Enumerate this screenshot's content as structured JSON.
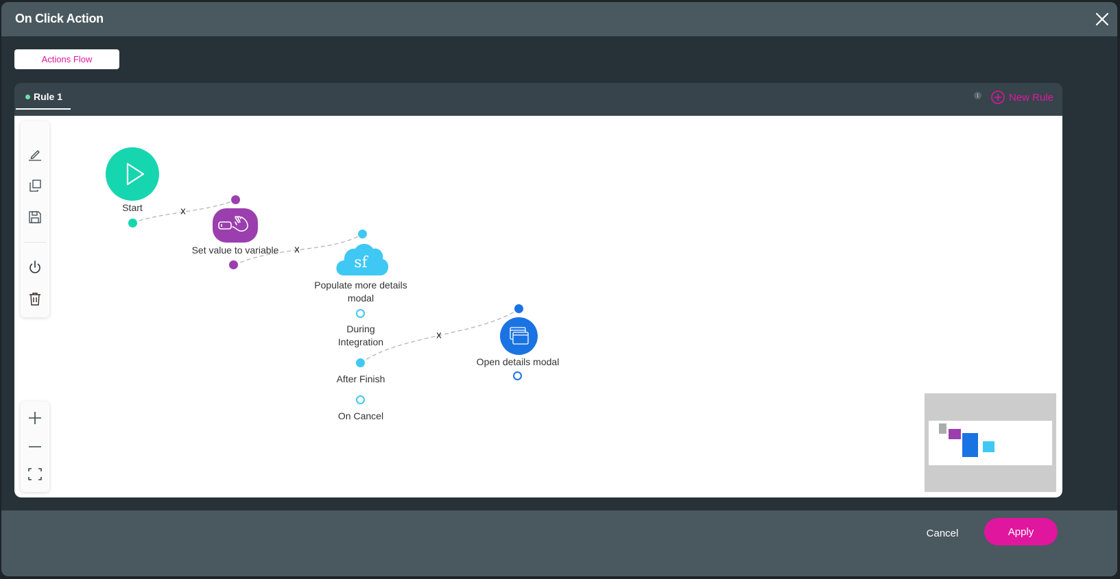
{
  "modal": {
    "title": "On Click Action",
    "close_icon": "close-icon"
  },
  "top_tab": {
    "label": "Actions Flow"
  },
  "rules": {
    "tabs": [
      {
        "label": "Rule 1",
        "active": true,
        "status_color": "#6fe0a8"
      }
    ],
    "info_icon": "info-icon",
    "new_rule_label": "New Rule"
  },
  "toolbar": {
    "items": [
      {
        "name": "edit",
        "icon": "pencil-icon"
      },
      {
        "name": "duplicate",
        "icon": "copy-icon"
      },
      {
        "name": "save",
        "icon": "save-icon"
      },
      {
        "name": "toggle-power",
        "icon": "power-icon"
      },
      {
        "name": "delete",
        "icon": "trash-icon"
      }
    ]
  },
  "zoom_controls": {
    "items": [
      {
        "name": "zoom-in",
        "icon": "plus-icon"
      },
      {
        "name": "zoom-out",
        "icon": "minus-icon"
      },
      {
        "name": "fit-screen",
        "icon": "fit-icon"
      }
    ]
  },
  "flow": {
    "nodes": [
      {
        "id": "start",
        "label": "Start",
        "icon": "play-icon",
        "color": "#16d6b0"
      },
      {
        "id": "set-value",
        "label": "Set value to variable",
        "icon": "hand-toggle-icon",
        "color": "#9b3fae"
      },
      {
        "id": "populate",
        "label": "Populate more details modal",
        "label_line1": "Populate more details",
        "label_line2": "modal",
        "icon": "salesforce-cloud-icon",
        "icon_text": "sf",
        "color": "#3fc8f4",
        "outputs": [
          {
            "label": "During",
            "label2": "Integration"
          },
          {
            "label": "After Finish"
          },
          {
            "label": "On Cancel"
          }
        ]
      },
      {
        "id": "open-modal",
        "label": "Open details modal",
        "icon": "window-icon",
        "color": "#1a73e3"
      }
    ],
    "edge_remove_label": "x"
  },
  "footer": {
    "cancel_label": "Cancel",
    "apply_label": "Apply"
  },
  "colors": {
    "accent": "#e0169e",
    "header_bg": "#4a5860",
    "body_bg": "#263238"
  }
}
